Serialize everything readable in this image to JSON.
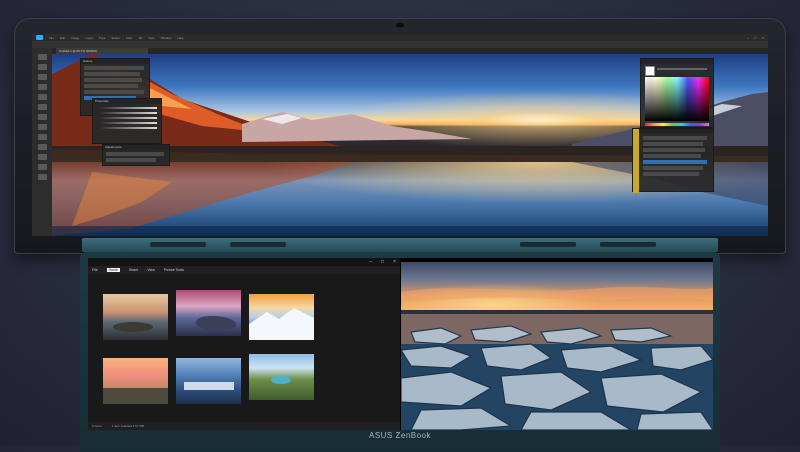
{
  "brand": {
    "label": "ASUS ZenBook"
  },
  "photoshop": {
    "menus": [
      "File",
      "Edit",
      "Image",
      "Layer",
      "Type",
      "Select",
      "Filter",
      "3D",
      "View",
      "Window",
      "Help"
    ],
    "document_tab": "Untitled-1 @ 66.7% (RGB/8)",
    "panels": {
      "history": "History",
      "properties": "Properties",
      "adjustments": "Adjustments"
    }
  },
  "explorer": {
    "ribbon_tabs": [
      "File",
      "Home",
      "Share",
      "View",
      "Picture Tools"
    ],
    "status_left": "6 items",
    "status_right": "1 item selected  4.57 MB"
  },
  "colors": {
    "ps_blue": "#31a8ff",
    "hinge_teal": "#3e6e7d",
    "base_teal": "#1d3a44"
  }
}
